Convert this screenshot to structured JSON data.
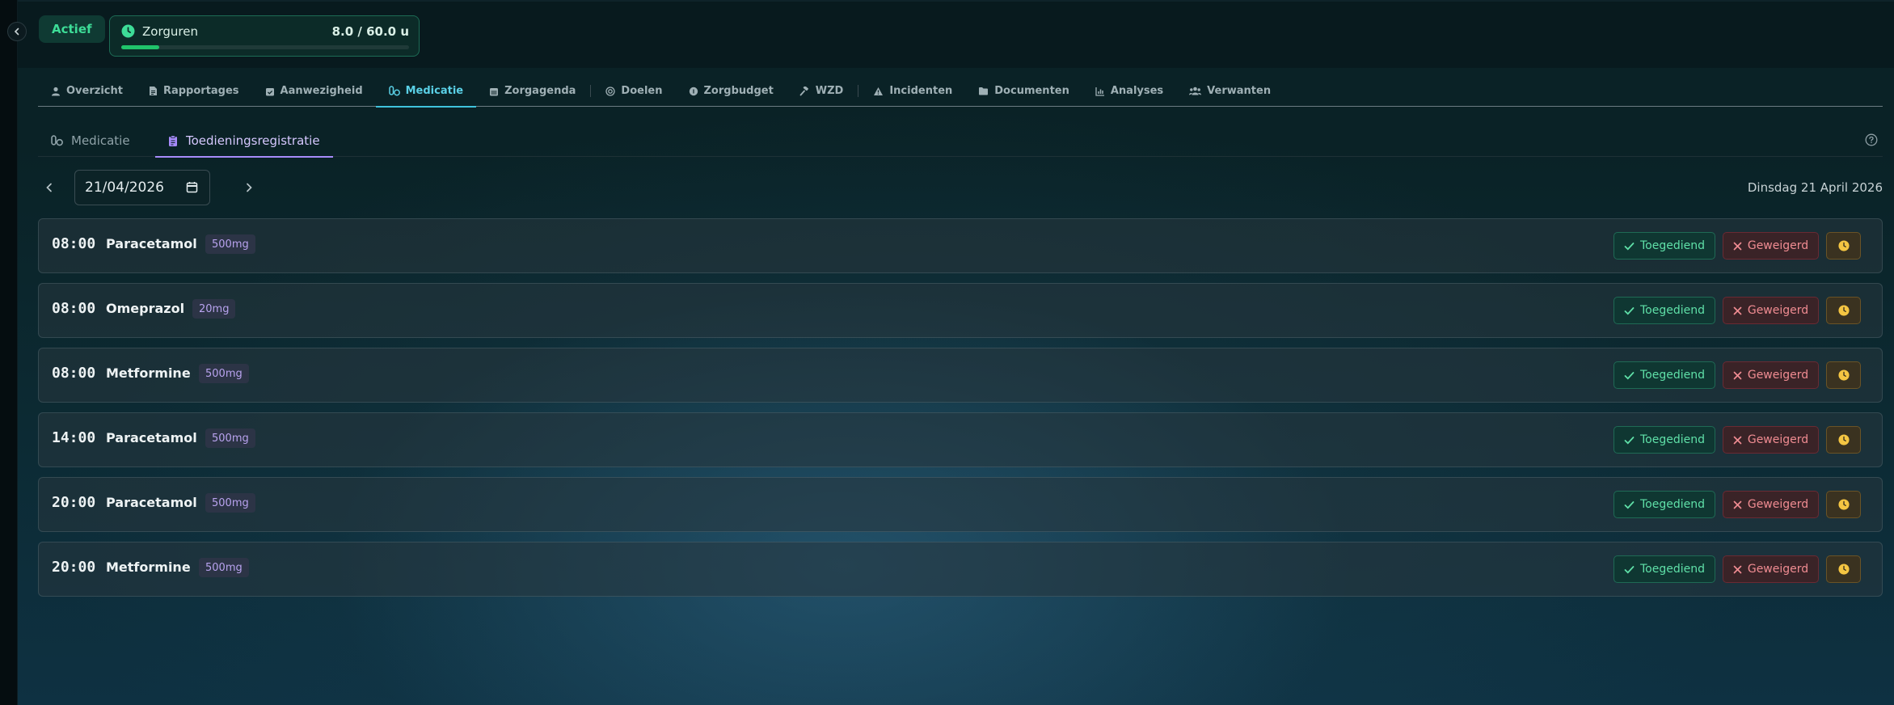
{
  "header": {
    "status": "Actief",
    "hours": {
      "title": "Zorguren",
      "value": "8.0 / 60.0 u",
      "progress_percent": 13.3,
      "accent": "#20c46b"
    }
  },
  "nav": {
    "items": [
      {
        "label": "Overzicht",
        "icon": "user-icon",
        "active": false
      },
      {
        "label": "Rapportages",
        "icon": "document-icon",
        "active": false
      },
      {
        "label": "Aanwezigheid",
        "icon": "calendar-check-icon",
        "active": false
      },
      {
        "label": "Medicatie",
        "icon": "pills-icon",
        "active": true
      },
      {
        "label": "Zorgagenda",
        "icon": "calendar-icon",
        "active": false
      },
      {
        "label": "Doelen",
        "icon": "target-icon",
        "active": false
      },
      {
        "label": "Zorgbudget",
        "icon": "coin-icon",
        "active": false
      },
      {
        "label": "WZD",
        "icon": "gavel-icon",
        "active": false
      },
      {
        "label": "Incidenten",
        "icon": "warning-icon",
        "active": false
      },
      {
        "label": "Documenten",
        "icon": "folder-icon",
        "active": false
      },
      {
        "label": "Analyses",
        "icon": "chart-icon",
        "active": false
      },
      {
        "label": "Verwanten",
        "icon": "users-icon",
        "active": false
      }
    ],
    "active_color": "#5ad0e6"
  },
  "subtabs": {
    "medicatie": "Medicatie",
    "registratie": "Toedieningsregistratie",
    "active": "registratie",
    "active_color": "#a78bfa"
  },
  "datebar": {
    "date_value": "2026-04-21",
    "date_display": "21/04/2026",
    "day_label": "Dinsdag 21 April 2026"
  },
  "actions": {
    "given_label": "Toegediend",
    "refused_label": "Geweigerd"
  },
  "doses": [
    {
      "time": "08:00",
      "name": "Paracetamol",
      "dose": "500mg"
    },
    {
      "time": "08:00",
      "name": "Omeprazol",
      "dose": "20mg"
    },
    {
      "time": "08:00",
      "name": "Metformine",
      "dose": "500mg"
    },
    {
      "time": "14:00",
      "name": "Paracetamol",
      "dose": "500mg"
    },
    {
      "time": "20:00",
      "name": "Paracetamol",
      "dose": "500mg"
    },
    {
      "time": "20:00",
      "name": "Metformine",
      "dose": "500mg"
    }
  ]
}
